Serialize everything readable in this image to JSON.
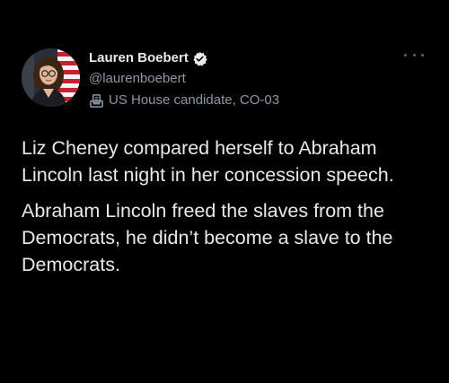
{
  "tweet": {
    "author": {
      "display_name": "Lauren Boebert",
      "handle": "@laurenboebert",
      "verified": true,
      "label": "US House candidate, CO-03",
      "label_icon": "ballot-box-icon",
      "avatar_icon": "profile-photo"
    },
    "more_icon": "more-options-icon",
    "paragraphs": [
      "Liz Cheney compared herself to Abraham Lincoln last night in her concession speech.",
      "Abraham Lincoln freed the slaves from the Democrats, he didn’t become a slave to the Democrats."
    ]
  },
  "colors": {
    "background": "#000000",
    "text_primary": "#e7e9ea",
    "text_secondary": "#8b98a5",
    "verified_badge": "#1d9bf0"
  }
}
